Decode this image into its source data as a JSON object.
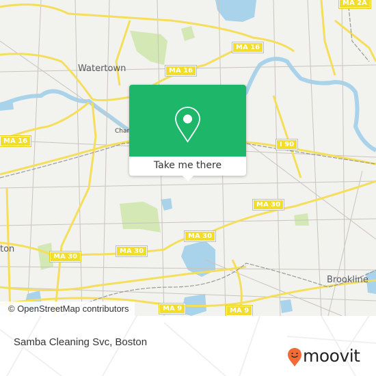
{
  "map": {
    "places": {
      "watertown": "Watertown",
      "newton_partial": "ton",
      "brookline": "Brookline",
      "charles_partial": "Charl"
    },
    "shields": {
      "ma16_top": "MA 16",
      "ma16_mid": "MA 16",
      "ma16_left": "MA 16",
      "ma2a": "MA 2A",
      "i90": "I 90",
      "ma30_a": "MA 30",
      "ma30_b": "MA 30",
      "ma30_c": "MA 30",
      "ma9": "MA 9"
    },
    "attribution": "© OpenStreetMap contributors",
    "colors": {
      "land": "#f2f2ee",
      "water": "#a9d3ea",
      "park": "#d3e8b4",
      "major_road": "#f5de5a",
      "minor_road": "#c9c4bd",
      "rail": "#999999"
    }
  },
  "popup": {
    "icon": "map-pin-icon",
    "button_label": "Take me there",
    "color": "#1eb769"
  },
  "footer": {
    "title": "Samba Cleaning Svc, Boston",
    "logo_text": "moovit",
    "logo_color": "#f26b37"
  }
}
